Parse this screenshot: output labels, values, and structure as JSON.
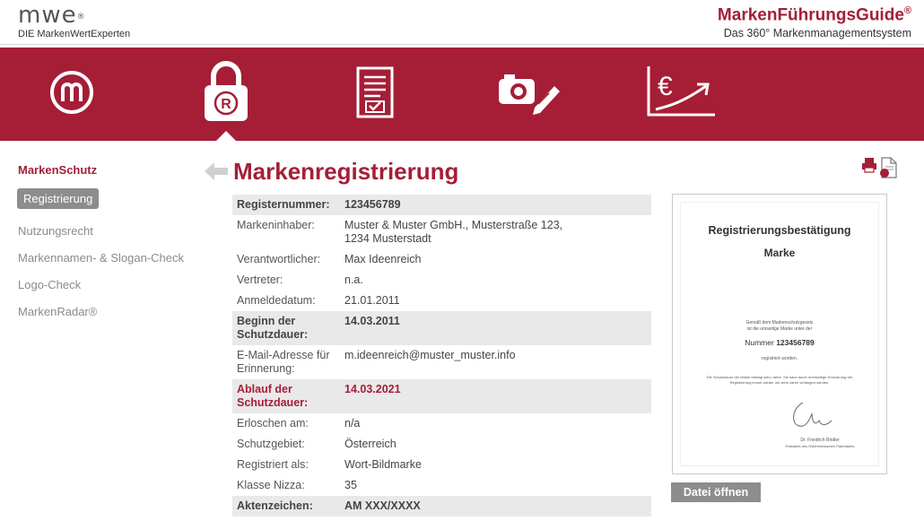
{
  "header": {
    "logo_text": "mwe",
    "logo_reg": "®",
    "logo_subtitle": "DIE MarkenWertExperten",
    "brand_title": "MarkenFührungsGuide",
    "brand_reg": "®",
    "brand_subtitle": "Das 360° Markenmanagementsystem"
  },
  "nav": {
    "items": [
      {
        "icon": "m-logo-icon"
      },
      {
        "icon": "lock-registered-icon",
        "active": true
      },
      {
        "icon": "document-check-icon"
      },
      {
        "icon": "camera-pencil-icon"
      },
      {
        "icon": "euro-growth-chart-icon"
      }
    ]
  },
  "sidebar": {
    "title": "MarkenSchutz",
    "items": [
      {
        "label": "Registrierung",
        "active": true
      },
      {
        "label": "Nutzungsrecht"
      },
      {
        "label": "Markennamen- & Slogan-Check"
      },
      {
        "label": "Logo-Check"
      },
      {
        "label": "MarkenRadar®"
      }
    ]
  },
  "main": {
    "title": "Markenregistrierung",
    "rows": [
      {
        "key": "Registernummer:",
        "value": "123456789",
        "style": "shade-bold"
      },
      {
        "key": "Markeninhaber:",
        "value": "Muster & Muster GmbH., Musterstraße 123,",
        "value2": "1234 Musterstadt",
        "style": "plain"
      },
      {
        "key": "Verantwortlicher:",
        "value": "Max Ideenreich",
        "style": "plain"
      },
      {
        "key": "Vertreter:",
        "value": "n.a.",
        "style": "plain"
      },
      {
        "key": "Anmeldedatum:",
        "value": "21.01.2011",
        "style": "plain"
      },
      {
        "key": "Beginn der",
        "key2": "Schutzdauer:",
        "value": "14.03.2011",
        "style": "shade-bold"
      },
      {
        "key": "E-Mail-Adresse für",
        "key2": "Erinnerung:",
        "value": "m.ideenreich@muster_muster.info",
        "style": "plain"
      },
      {
        "key": "Ablauf der",
        "key2": "Schutzdauer:",
        "value": "14.03.2021",
        "style": "shade-red"
      },
      {
        "key": "Erloschen am:",
        "value": "n/a",
        "style": "plain"
      },
      {
        "key": "Schutzgebiet:",
        "value": "Österreich",
        "style": "plain"
      },
      {
        "key": "Registriert als:",
        "value": "Wort-Bildmarke",
        "style": "plain"
      },
      {
        "key": "Klasse Nizza:",
        "value": "35",
        "style": "plain"
      },
      {
        "key": "Aktenzeichen:",
        "value": "AM XXX/XXXX",
        "style": "shade-bold"
      }
    ]
  },
  "certificate": {
    "title": "Registrierungsbestätigung",
    "subtitle": "Marke",
    "text1": "Gemäß dem Markenschutzgesetz",
    "text2": "ist die umseitige Marke unter der",
    "number_label": "Nummer",
    "number_value": "123456789",
    "text3": "registriert worden.",
    "text4": "Die Schutzdauer der Marke beträgt zehn Jahre. Sie kann durch rechtzeitige Erneuerung der",
    "text5": "Registrierung immer wieder um zehn Jahre verlängert werden.",
    "signer": "Dr. Friedrich Rödler",
    "signer_title": "Präsident des Österreichischen Patentamts",
    "open_button": "Datei öffnen"
  },
  "colors": {
    "brand_red": "#a51e36",
    "gray_button": "#8d8d8d",
    "row_shade": "#e9e9e9"
  }
}
